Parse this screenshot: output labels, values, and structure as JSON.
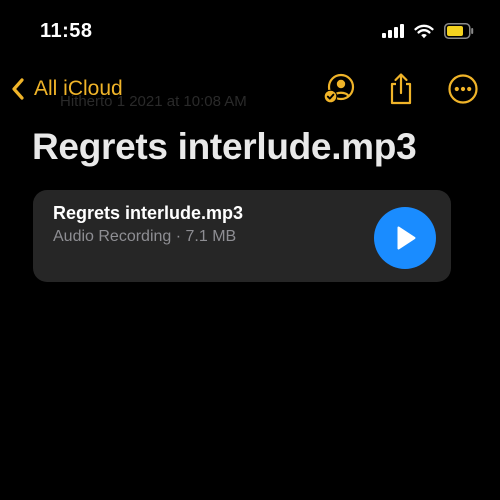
{
  "status_bar": {
    "time": "11:58",
    "icons": [
      "cellular-signal-icon",
      "wifi-icon",
      "battery-icon"
    ]
  },
  "nav": {
    "back_label": "All iCloud",
    "actions": [
      "collaborate-icon",
      "share-icon",
      "more-icon"
    ],
    "ghost_text": "Hitherto 1 2021 at 10:08 AM"
  },
  "note": {
    "title": "Regrets interlude.mp3"
  },
  "attachment": {
    "file_name": "Regrets interlude.mp3",
    "meta": "Audio Recording · 7.1 MB",
    "action_icon": "play-icon"
  },
  "colors": {
    "background": "#000000",
    "accent": "#f0b429",
    "card": "#262626",
    "play": "#1a8cff",
    "title": "#e9e9e9",
    "secondary_text": "#8e8e93",
    "battery_fill": "#f4d21f"
  }
}
